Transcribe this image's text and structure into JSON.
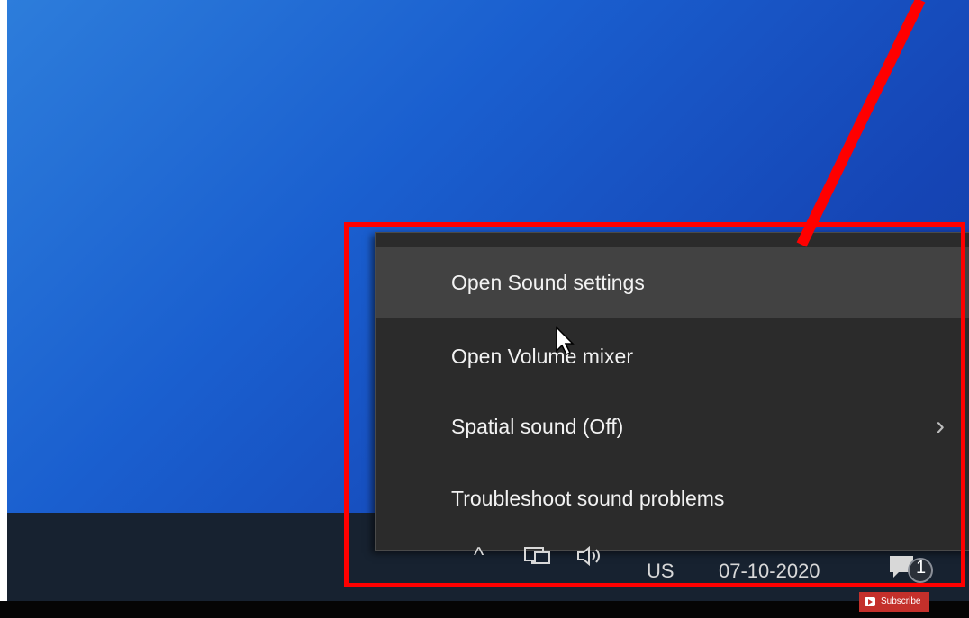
{
  "menu": {
    "items": [
      {
        "label": "Open Sound settings"
      },
      {
        "label": "Open Volume mixer"
      },
      {
        "label": "Spatial sound (Off)"
      },
      {
        "label": "Troubleshoot sound problems"
      }
    ]
  },
  "tray": {
    "caret": "^",
    "language": "US",
    "date": "07-10-2020",
    "notification_count": "1"
  },
  "subscribe": {
    "label": "Subscribe"
  },
  "colors": {
    "annotation": "#ff0000",
    "menu_bg": "#2b2b2b",
    "menu_highlight": "#424242",
    "desktop": "#1a5fcf"
  }
}
